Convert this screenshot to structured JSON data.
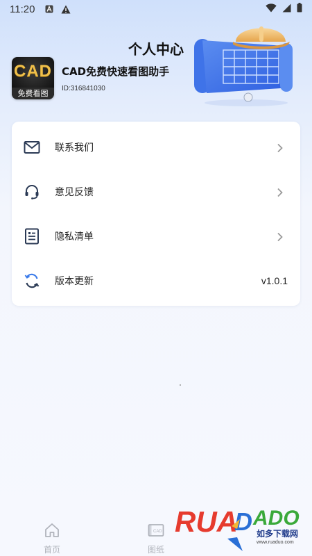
{
  "status_bar": {
    "time": "11:20",
    "icons": [
      "a-letter-icon",
      "warning-icon",
      "wifi-icon",
      "signal-icon",
      "battery-icon"
    ]
  },
  "header": {
    "title": "个人中心"
  },
  "profile": {
    "logo_text": "CAD",
    "logo_subtext": "免费看图",
    "app_name": "CAD免费快速看图助手",
    "user_id": "ID:316841030"
  },
  "menu": {
    "items": [
      {
        "label": "联系我们",
        "icon": "mail-icon",
        "trailing": "chevron"
      },
      {
        "label": "意见反馈",
        "icon": "headset-icon",
        "trailing": "chevron"
      },
      {
        "label": "隐私清单",
        "icon": "document-list-icon",
        "trailing": "chevron"
      },
      {
        "label": "版本更新",
        "icon": "refresh-icon",
        "trailing": "v1.0.1"
      }
    ]
  },
  "tabs": [
    {
      "label": "首页",
      "icon": "home-icon"
    },
    {
      "label": "图纸",
      "icon": "drawing-icon"
    }
  ],
  "watermark": {
    "brand": "RUANDUO",
    "subtitle": "如多下载网",
    "url": "www.ruaduo.com"
  },
  "colors": {
    "accent_icon": "#2b3a55",
    "refresh_icon": "#3b7bea",
    "logo_gold": "#f1c04a",
    "tab_inactive": "#b0b3bb",
    "watermark_red": "#e63b2e",
    "watermark_green": "#3aa93a",
    "watermark_blue": "#2a6fd6"
  }
}
